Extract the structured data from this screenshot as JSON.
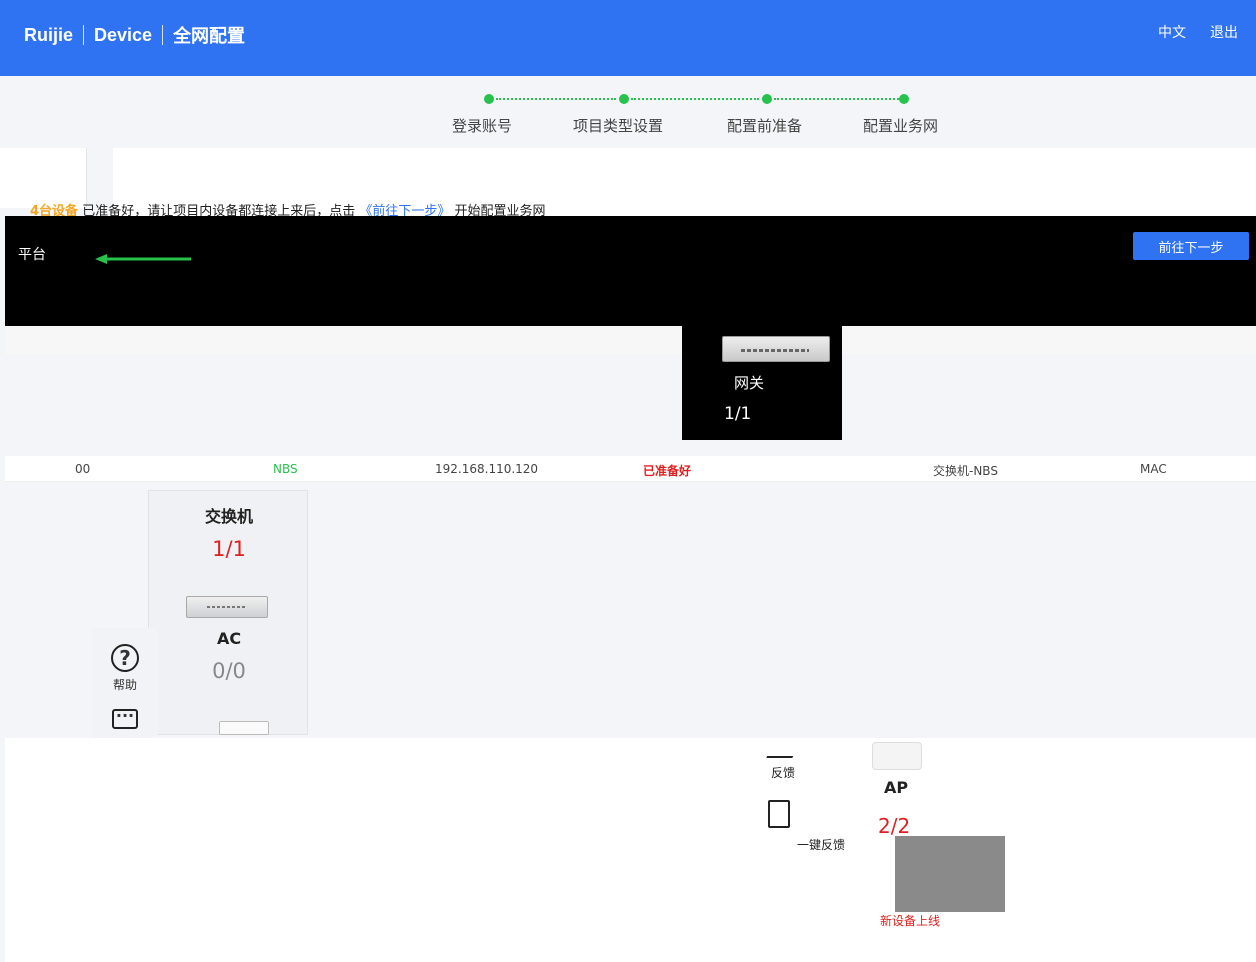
{
  "header": {
    "brand": "Ruijie",
    "product": "Device",
    "subtitle": "全网配置",
    "lang": "中文",
    "logout": "退出"
  },
  "steps": [
    {
      "label": "登录账号"
    },
    {
      "label": "项目类型设置"
    },
    {
      "label": "配置前准备"
    },
    {
      "label": "配置业务网"
    }
  ],
  "notice": {
    "count": "4台设备",
    "text": "已准备好，请让项目内设备都连接上来后，点击",
    "link": "《前往下一步》",
    "suffix": "开始配置业务网"
  },
  "next_button": "前往下一步",
  "topology": {
    "left_label": "平台",
    "gateway": {
      "label": "网关",
      "count": "1/1"
    }
  },
  "table": {
    "rows": [
      {
        "sn": "00",
        "model": "NBS",
        "ip": "192.168.110.120",
        "status": "已准备好",
        "type": "交换机-NBS",
        "mac": "MAC"
      }
    ]
  },
  "devices": [
    {
      "name": "交换机",
      "count": "1/1"
    },
    {
      "name": "AC",
      "count": "0/0"
    }
  ],
  "help": {
    "label": "帮助"
  },
  "feedback": {
    "label": "反馈"
  },
  "onekey": {
    "label": "一键反馈"
  },
  "ap": {
    "name": "AP",
    "count": "2/2"
  },
  "bottom_link": "新设备上线"
}
